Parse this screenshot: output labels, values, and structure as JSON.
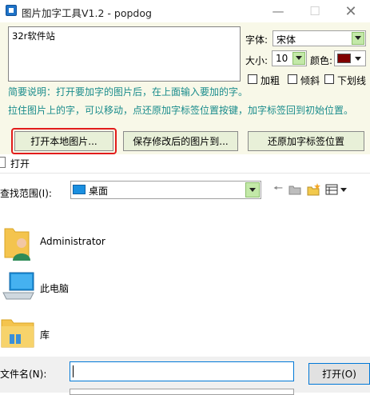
{
  "app": {
    "title": "图片加字工具V1.2 - popdog",
    "text_value": "32r软件站",
    "font_label": "字体:",
    "font_value": "宋体",
    "size_label": "大小:",
    "size_value": "10",
    "color_label": "颜色:",
    "color_value": "#800000",
    "bold_label": "加粗",
    "italic_label": "倾斜",
    "underline_label": "下划线",
    "info_line1": "简要说明：打开要加字的图片后，在上面输入要加的字。",
    "info_line2": "拉住图片上的字，可以移动，点还原加字标签位置按键，加字标签回到初始位置。",
    "open_image_button": "打开本地图片...",
    "save_image_button": "保存修改后的图片到...",
    "restore_position_button": "还原加字标签位置"
  },
  "dialog": {
    "title": "打开",
    "lookin_label": "查找范围(I):",
    "lookin_value": "桌面",
    "items": [
      {
        "label": "Administrator",
        "icon": "user-folder-icon"
      },
      {
        "label": "此电脑",
        "icon": "computer-icon"
      },
      {
        "label": "库",
        "icon": "library-folder-icon"
      }
    ],
    "filename_label": "文件名(N):",
    "filename_value": "",
    "open_button": "打开(O)"
  },
  "colors": {
    "app_background": "#f8f8e8",
    "info_text": "#1a8c8c",
    "highlight": "#e21c1c",
    "focus": "#0078d7"
  }
}
